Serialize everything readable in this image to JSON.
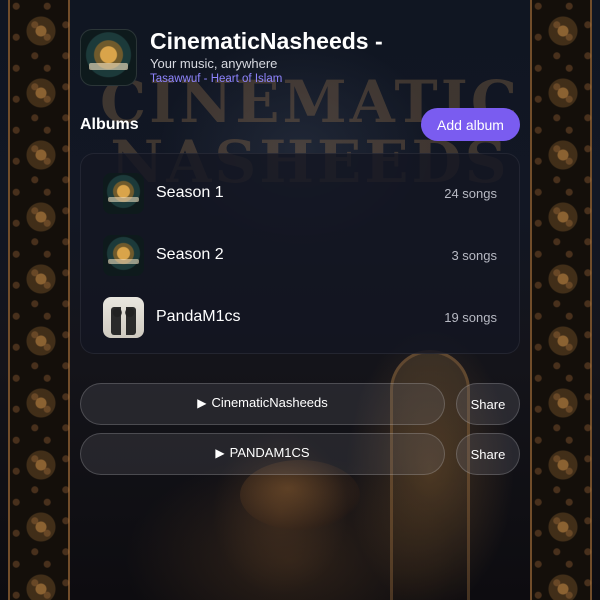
{
  "header": {
    "title": "CinematicNasheeds -",
    "subtitle": "Your music, anywhere",
    "now_playing": "Tasawwuf - Heart of Islam",
    "logo_icon": "cinematic-nasheeds-logo"
  },
  "background": {
    "title_text": "CINEMATIC NASHEEDS"
  },
  "albums": {
    "label": "Albums",
    "add_button": "Add album",
    "items": [
      {
        "name": "Season 1",
        "count": "24 songs",
        "thumb": "cinematic-nasheeds-logo"
      },
      {
        "name": "Season 2",
        "count": "3 songs",
        "thumb": "cinematic-nasheeds-logo"
      },
      {
        "name": "PandaM1cs",
        "count": "19 songs",
        "thumb": "pandam1cs-cover"
      }
    ]
  },
  "playlists": [
    {
      "label": "CinematicNasheeds",
      "play_icon": "play-triangle-icon",
      "share_label": "Share"
    },
    {
      "label": "PANDAM1CS",
      "play_icon": "play-triangle-icon",
      "share_label": "Share"
    }
  ],
  "colors": {
    "accent": "#7a5cf0",
    "now_playing": "#8f84ff",
    "card_bg": "#141622"
  }
}
